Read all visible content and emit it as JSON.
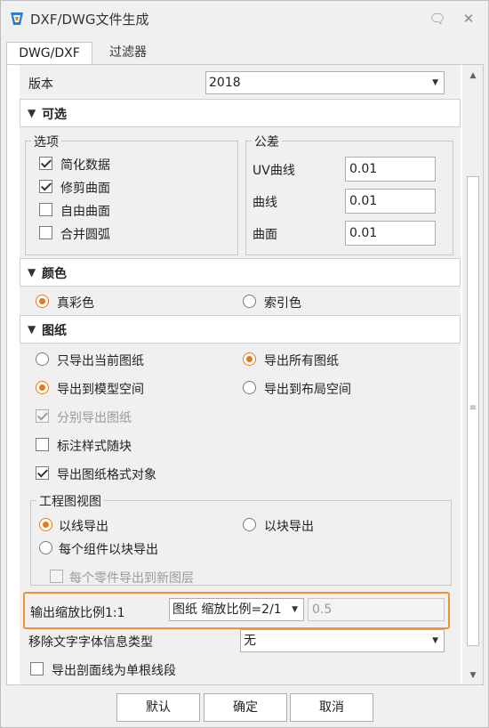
{
  "window": {
    "title": "DXF/DWG文件生成"
  },
  "tabs": [
    {
      "label": "DWG/DXF"
    },
    {
      "label": "过滤器"
    }
  ],
  "version": {
    "label": "版本",
    "value": "2018"
  },
  "optional": {
    "title": "可选",
    "options_group": {
      "title": "选项",
      "items": [
        {
          "label": "简化数据",
          "checked": true
        },
        {
          "label": "修剪曲面",
          "checked": true
        },
        {
          "label": "自由曲面",
          "checked": false
        },
        {
          "label": "合并圆弧",
          "checked": false
        }
      ]
    },
    "tolerance_group": {
      "title": "公差",
      "items": [
        {
          "label": "UV曲线",
          "value": "0.01"
        },
        {
          "label": "曲线",
          "value": "0.01"
        },
        {
          "label": "曲面",
          "value": "0.01"
        }
      ]
    }
  },
  "color": {
    "title": "颜色",
    "options": [
      {
        "label": "真彩色",
        "selected": true
      },
      {
        "label": "索引色",
        "selected": false
      }
    ]
  },
  "drawing": {
    "title": "图纸",
    "export_scope": [
      {
        "label": "只导出当前图纸",
        "selected": false
      },
      {
        "label": "导出所有图纸",
        "selected": true
      }
    ],
    "export_space": [
      {
        "label": "导出到模型空间",
        "selected": true
      },
      {
        "label": "导出到布局空间",
        "selected": false
      }
    ],
    "checks": [
      {
        "label": "分别导出图纸",
        "checked": true,
        "disabled": true
      },
      {
        "label": "标注样式随块",
        "checked": false,
        "disabled": false
      },
      {
        "label": "导出图纸格式对象",
        "checked": true,
        "disabled": false
      }
    ],
    "view_group": {
      "title": "工程图视图",
      "options": [
        {
          "label": "以线导出",
          "selected": true
        },
        {
          "label": "以块导出",
          "selected": false
        },
        {
          "label": "每个组件以块导出",
          "selected": false
        }
      ],
      "sub_check": {
        "label": "每个零件导出到新图层",
        "checked": false,
        "disabled": true
      }
    }
  },
  "scale": {
    "label": "输出缩放比例1:1",
    "dropdown_value": "图纸 缩放比例=2/1",
    "value": "0.5"
  },
  "font_info": {
    "label": "移除文字字体信息类型",
    "value": "无"
  },
  "section_lines": {
    "label": "导出剖面线为单根线段",
    "checked": false
  },
  "buttons": {
    "default": "默认",
    "ok": "确定",
    "cancel": "取消"
  },
  "colors": {
    "accent": "#e07b1f",
    "highlight_border": "#f0913a"
  }
}
